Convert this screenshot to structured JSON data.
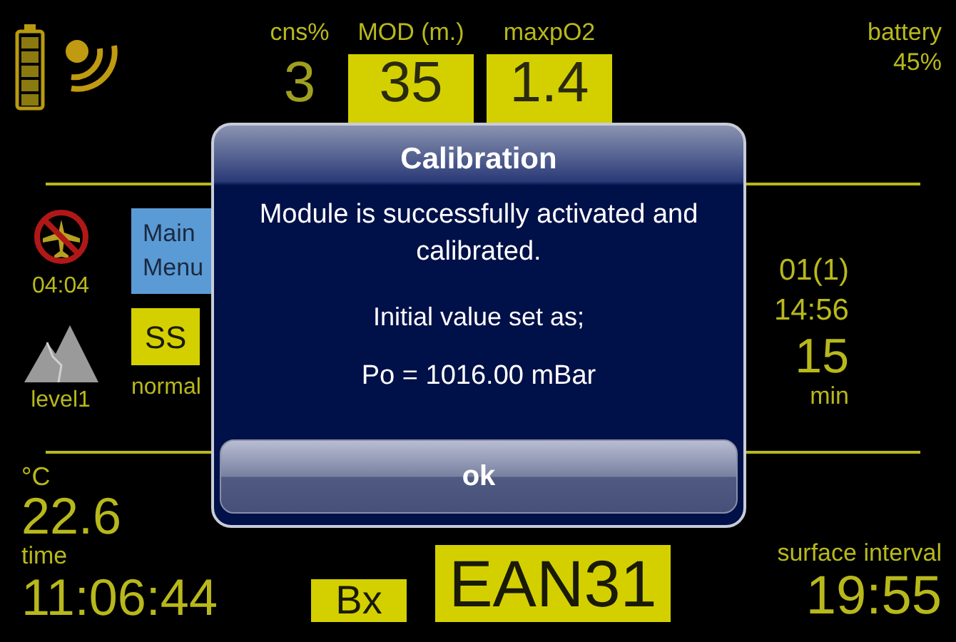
{
  "status": {
    "battery_label": "battery",
    "battery_value": "45%"
  },
  "gauges": [
    {
      "label": "cns%",
      "value": "3",
      "highlighted": false
    },
    {
      "label": "MOD (m.)",
      "value": "35",
      "highlighted": true
    },
    {
      "label": "maxpO2",
      "value": "1.4",
      "highlighted": true
    }
  ],
  "no_fly": {
    "time": "04:04"
  },
  "altitude": {
    "label": "level1"
  },
  "menu_buttons": [
    {
      "label": "Main Menu"
    }
  ],
  "modes": [
    {
      "label": "SS",
      "selected": true
    }
  ],
  "mode_caption": "normal",
  "last_dive": {
    "title": "01(1)",
    "time": "14:56",
    "duration": "15",
    "duration_unit": "min"
  },
  "temperature": {
    "unit": "°C",
    "value": "22.6"
  },
  "clock": {
    "label": "time",
    "value": "11:06:44"
  },
  "model": {
    "options": [
      {
        "label": "Bx",
        "selected": true
      }
    ]
  },
  "gas": {
    "value": "EAN31"
  },
  "surface_interval": {
    "label": "surface interval",
    "value": "19:55"
  },
  "dialog": {
    "title": "Calibration",
    "message": "Module is successfully activated and calibrated.",
    "detail": "Initial value set as;",
    "reading": "Po = 1016.00 mBar",
    "button": "ok"
  }
}
